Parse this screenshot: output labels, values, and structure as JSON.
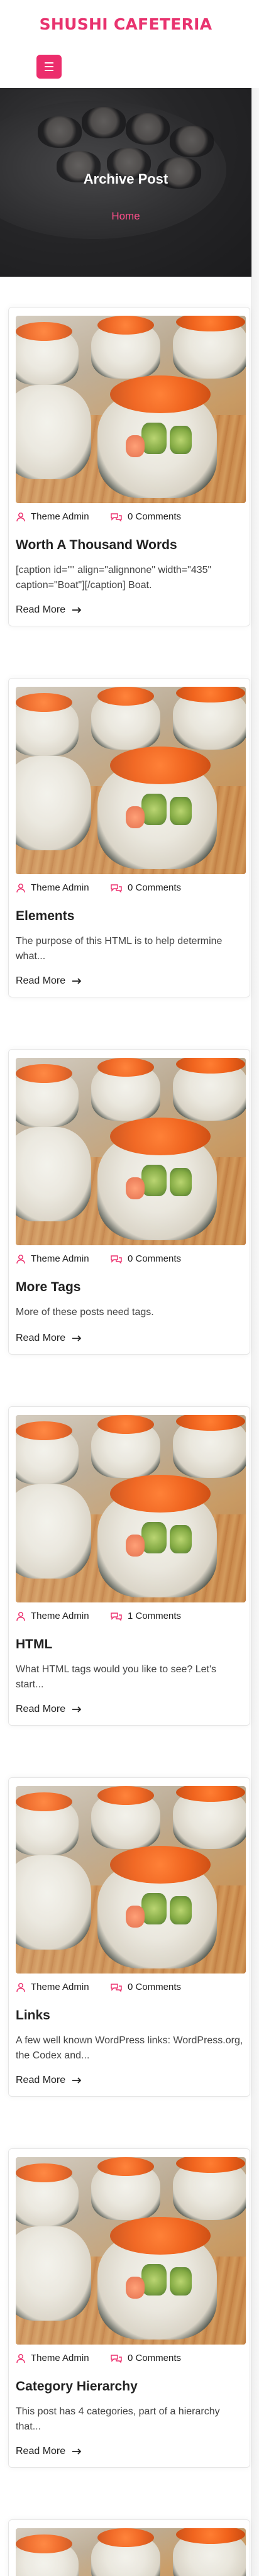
{
  "site": {
    "title": "SHUSHI CAFETERIA",
    "menu_icon": "hamburger-menu-icon",
    "accent_color": "#ec2d6c"
  },
  "banner": {
    "title": "Archive Post",
    "breadcrumb": "Home"
  },
  "posts": [
    {
      "author": "Theme Admin",
      "comments": "0 Comments",
      "title": "Worth A Thousand Words",
      "excerpt": "[caption id=\"\" align=\"alignnone\" width=\"435\" caption=\"Boat\"][/caption] Boat.",
      "read_more": "Read More"
    },
    {
      "author": "Theme Admin",
      "comments": "0 Comments",
      "title": "Elements",
      "excerpt": "The purpose of this HTML is to help determine what...",
      "read_more": "Read More"
    },
    {
      "author": "Theme Admin",
      "comments": "0 Comments",
      "title": "More Tags",
      "excerpt": "More of these posts need tags.",
      "read_more": "Read More"
    },
    {
      "author": "Theme Admin",
      "comments": "1 Comments",
      "title": "HTML",
      "excerpt": "What HTML tags would you like to see? Let's start...",
      "read_more": "Read More"
    },
    {
      "author": "Theme Admin",
      "comments": "0 Comments",
      "title": "Links",
      "excerpt": "A few well known WordPress links: WordPress.org, the Codex and...",
      "read_more": "Read More"
    },
    {
      "author": "Theme Admin",
      "comments": "0 Comments",
      "title": "Category Hierarchy",
      "excerpt": "This post has 4 categories, part of a hierarchy that...",
      "read_more": "Read More"
    }
  ]
}
